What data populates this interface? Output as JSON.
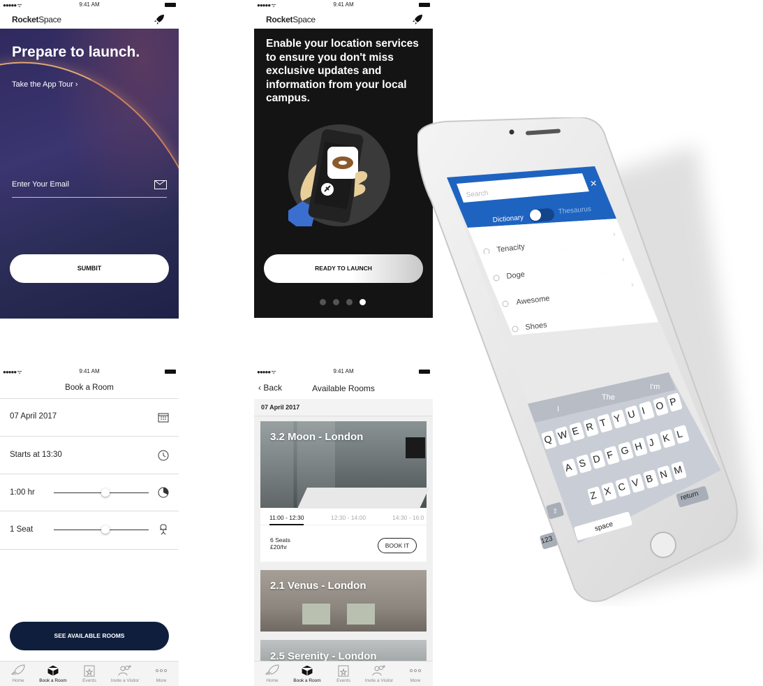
{
  "status": {
    "time": "9:41 AM",
    "signal": "●●●●● ᯤ"
  },
  "brand": {
    "part1": "Rocket",
    "part2": "Space"
  },
  "launch_screen": {
    "title": "Prepare to launch.",
    "tour_link": "Take the App Tour",
    "email_placeholder": "Enter Your Email",
    "submit_label": "SUMBIT"
  },
  "location_screen": {
    "message": "Enable your location services to ensure you don't miss exclusive updates and information from your local campus.",
    "cta_label": "READY TO LAUNCH",
    "pages": 4,
    "active_page": 4
  },
  "book_screen": {
    "title": "Book a Room",
    "date": "07 April 2017",
    "start": "Starts at 13:30",
    "duration": "1:00 hr",
    "seats": "1 Seat",
    "duration_level": 0.55,
    "seats_level": 0.55,
    "cta_label": "SEE AVAILABLE ROOMS"
  },
  "tabs": [
    {
      "label": "Home",
      "icon": "rocket-icon"
    },
    {
      "label": "Book a Room",
      "icon": "cube-icon"
    },
    {
      "label": "Events",
      "icon": "calendar-icon"
    },
    {
      "label": "Invite a Visitor",
      "icon": "users-icon"
    },
    {
      "label": "More",
      "icon": "more-icon"
    }
  ],
  "rooms_screen": {
    "back_label": "Back",
    "title": "Available Rooms",
    "date": "07 April 2017",
    "rooms": [
      {
        "name": "3.2 Moon - London",
        "times": [
          "11:00 - 12:30",
          "12:30 - 14:00",
          "14:30 - 16:0"
        ],
        "seats": "6 Seats",
        "price": "£20/hr",
        "book_label": "BOOK IT"
      },
      {
        "name": "2.1 Venus - London"
      },
      {
        "name": "2.5 Serenity  - London"
      }
    ]
  },
  "dictionary_app": {
    "search_placeholder": "Search",
    "close": "×",
    "toggle_left": "Dictionary",
    "toggle_right": "Thesaurus",
    "words": [
      "Tenacity",
      "Doge",
      "Awesome",
      "Shoes"
    ],
    "suggestions": [
      "I",
      "The",
      "I'm"
    ],
    "keyboard_row1": [
      "Q",
      "W",
      "E",
      "R",
      "T",
      "Y",
      "U",
      "I",
      "O",
      "P"
    ],
    "keyboard_row2": [
      "A",
      "S",
      "D",
      "F",
      "G",
      "H",
      "J",
      "K",
      "L"
    ],
    "keyboard_row3": [
      "Z",
      "X",
      "C",
      "V",
      "B",
      "N",
      "M"
    ],
    "key_numbers": "123",
    "key_space": "space",
    "key_return": "return"
  }
}
